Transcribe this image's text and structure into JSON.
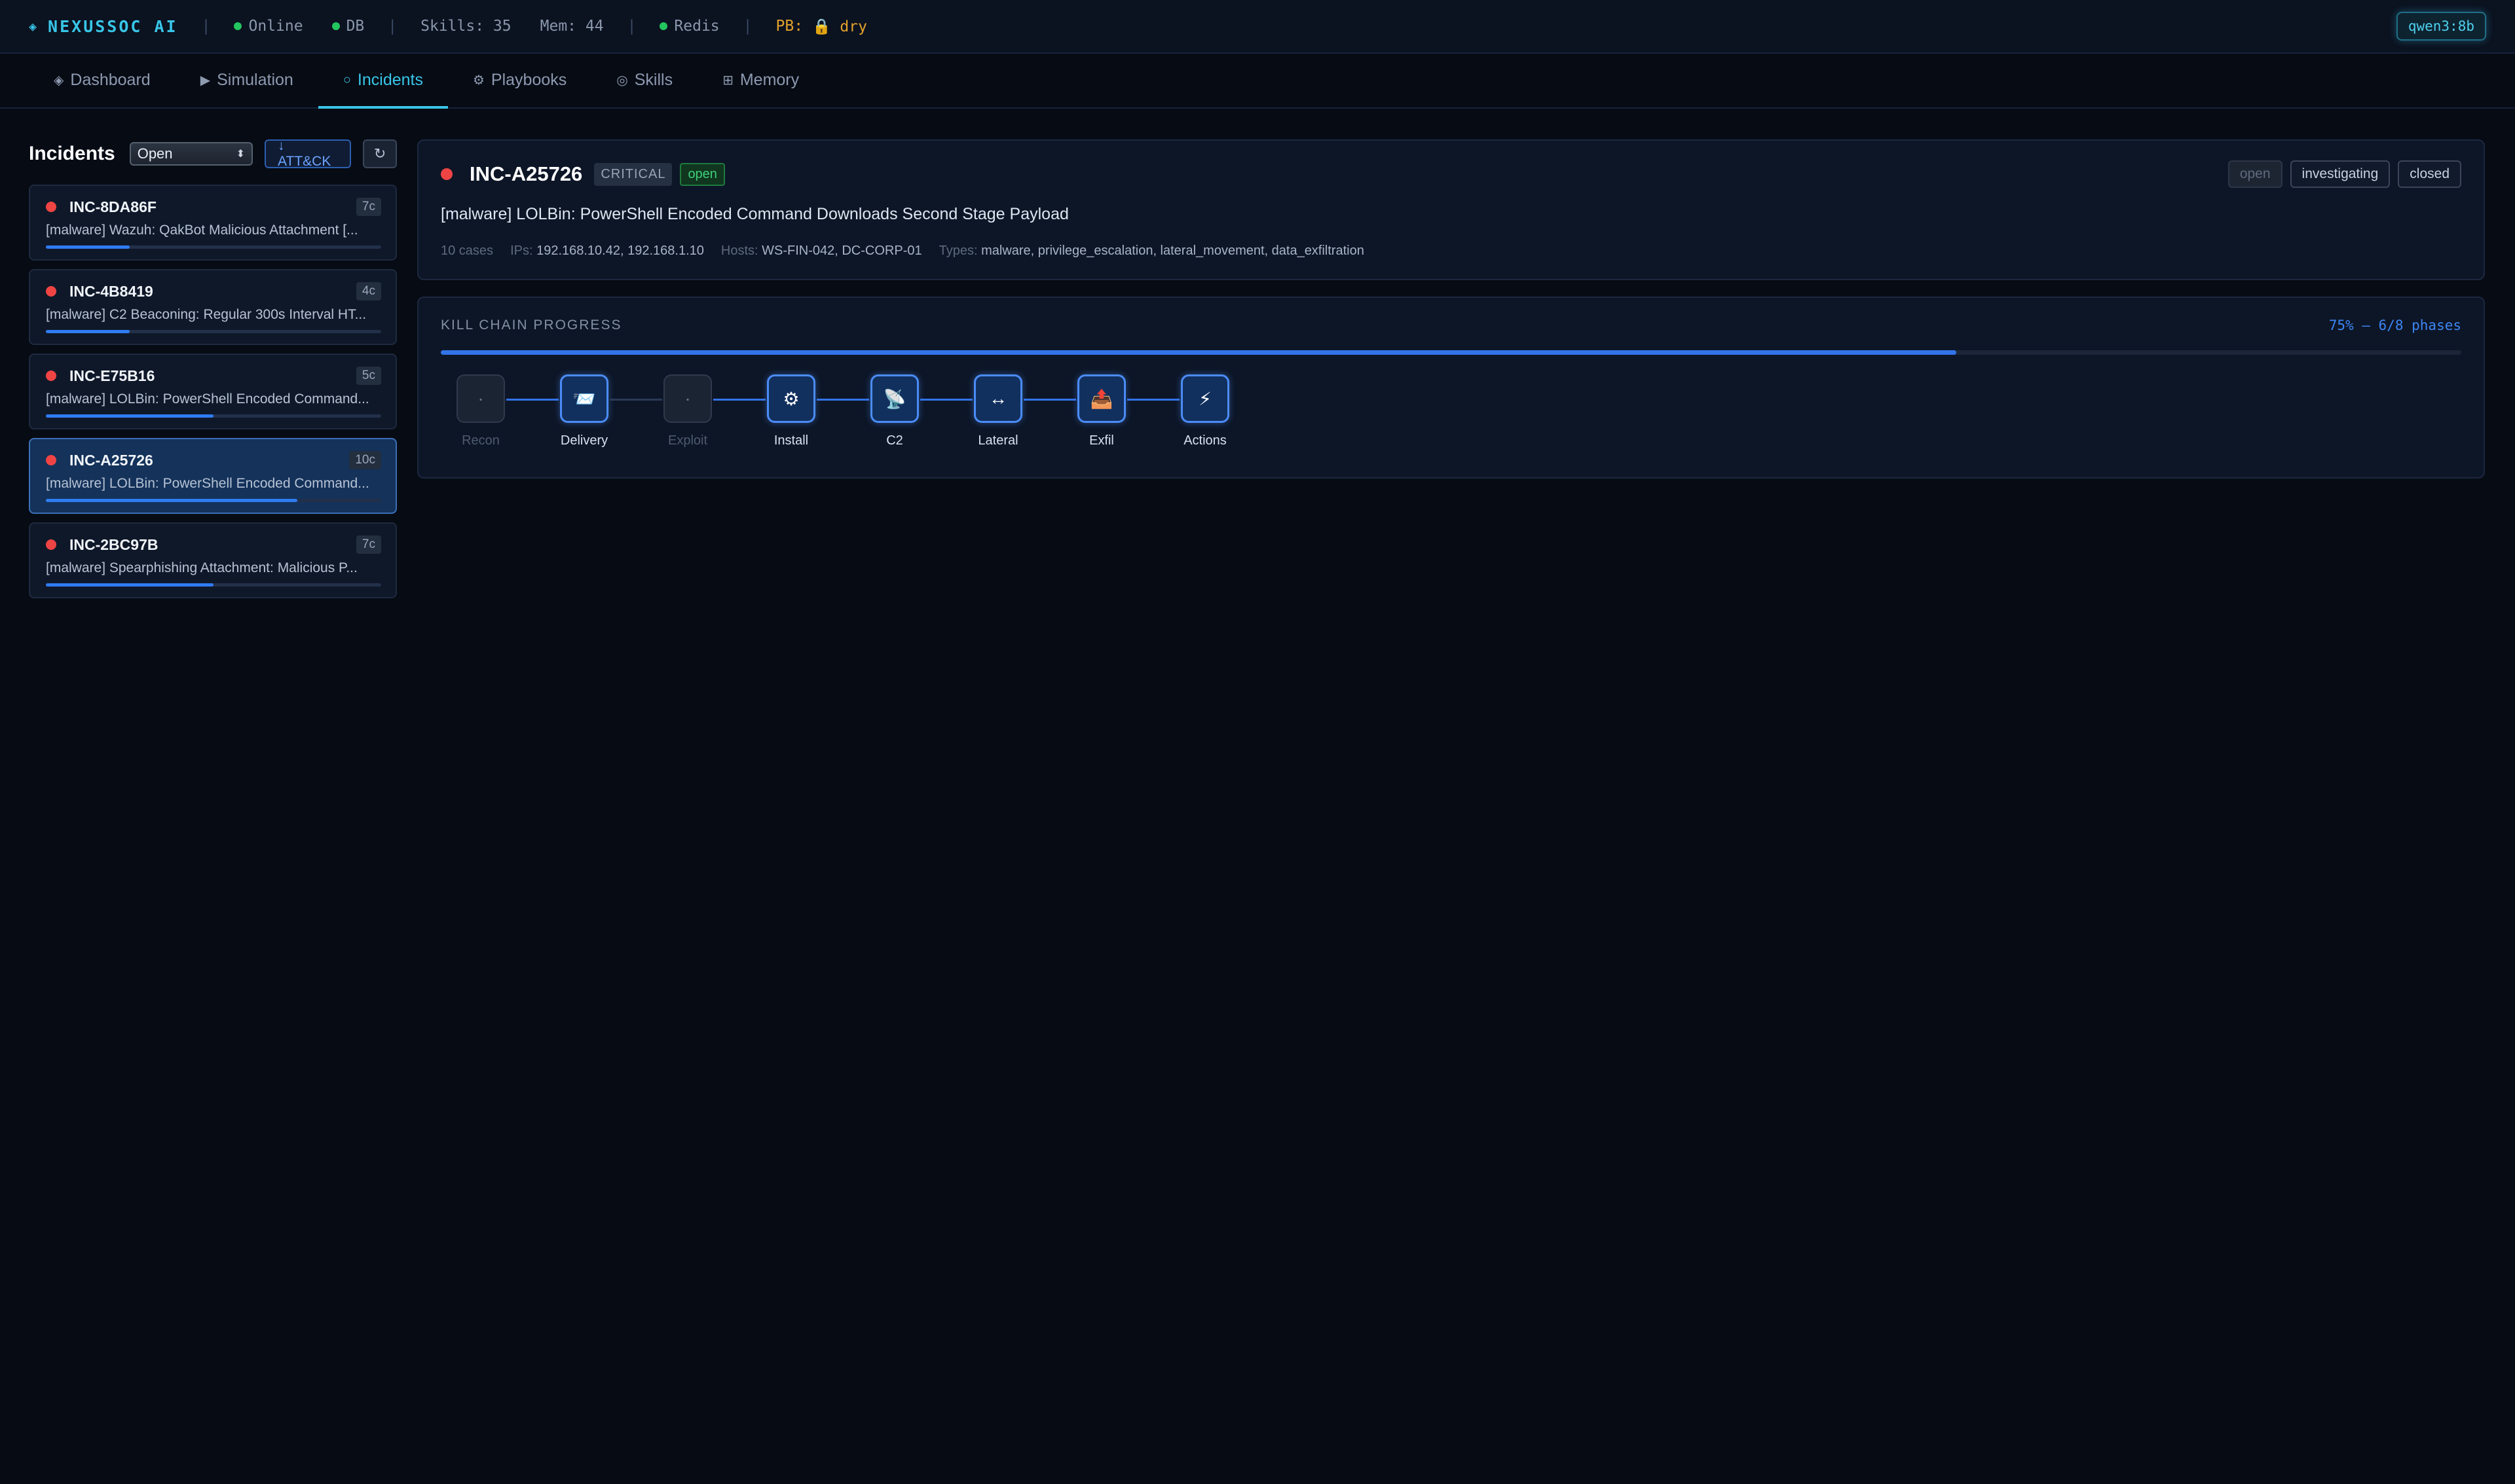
{
  "topbar": {
    "brand": "NEXUSSOC AI",
    "brand_icon": "◈",
    "status_online": "Online",
    "status_db": "DB",
    "skills": "Skills: 35",
    "memory": "Mem: 44",
    "status_redis": "Redis",
    "pb_label": "PB:",
    "pb_value": "🔒 dry",
    "model": "qwen3:8b",
    "online_color": "#22c55e"
  },
  "nav": {
    "tabs": [
      {
        "icon": "◈",
        "label": "Dashboard",
        "active": false
      },
      {
        "icon": "▶",
        "label": "Simulation",
        "active": false
      },
      {
        "icon": "○",
        "label": "Incidents",
        "active": true
      },
      {
        "icon": "⚙",
        "label": "Playbooks",
        "active": false
      },
      {
        "icon": "◎",
        "label": "Skills",
        "active": false
      },
      {
        "icon": "⊞",
        "label": "Memory",
        "active": false
      }
    ]
  },
  "incidents": {
    "title": "Incidents",
    "filter_value": "Open",
    "attack_button": "↓ ATT&CK",
    "refresh_icon": "↻",
    "items": [
      {
        "id": "INC-8DA86F",
        "count": "7c",
        "title": "[malware] Wazuh: QakBot Malicious Attachment [...",
        "progress": 0.25,
        "selected": false
      },
      {
        "id": "INC-4B8419",
        "count": "4c",
        "title": "[malware] C2 Beaconing: Regular 300s Interval HT...",
        "progress": 0.25,
        "selected": false
      },
      {
        "id": "INC-E75B16",
        "count": "5c",
        "title": "[malware] LOLBin: PowerShell Encoded Command...",
        "progress": 0.5,
        "selected": false
      },
      {
        "id": "INC-A25726",
        "count": "10c",
        "title": "[malware] LOLBin: PowerShell Encoded Command...",
        "progress": 0.75,
        "selected": true
      },
      {
        "id": "INC-2BC97B",
        "count": "7c",
        "title": "[malware] Spearphishing Attachment: Malicious P...",
        "progress": 0.5,
        "selected": false
      }
    ]
  },
  "detail": {
    "id": "INC-A25726",
    "severity": "CRITICAL",
    "status": "open",
    "status_buttons": [
      "open",
      "investigating",
      "closed"
    ],
    "title": "[malware] LOLBin: PowerShell Encoded Command Downloads Second Stage Payload",
    "cases": "10 cases",
    "ips_label": "IPs:",
    "ips": "192.168.10.42, 192.168.1.10",
    "hosts_label": "Hosts:",
    "hosts": "WS-FIN-042, DC-CORP-01",
    "types_label": "Types:",
    "types": "malware, privilege_escalation, lateral_movement, data_exfiltration"
  },
  "killchain": {
    "title": "KILL CHAIN PROGRESS",
    "summary": "75% — 6/8 phases",
    "progress": 0.75,
    "phases": [
      {
        "label": "Recon",
        "icon": "·",
        "active": false
      },
      {
        "label": "Delivery",
        "icon": "📨",
        "active": true
      },
      {
        "label": "Exploit",
        "icon": "·",
        "active": false
      },
      {
        "label": "Install",
        "icon": "⚙",
        "active": true
      },
      {
        "label": "C2",
        "icon": "📡",
        "active": true
      },
      {
        "label": "Lateral",
        "icon": "↔",
        "active": true
      },
      {
        "label": "Exfil",
        "icon": "📤",
        "active": true
      },
      {
        "label": "Actions",
        "icon": "⚡",
        "active": true
      }
    ],
    "accent": "#3273e8"
  }
}
